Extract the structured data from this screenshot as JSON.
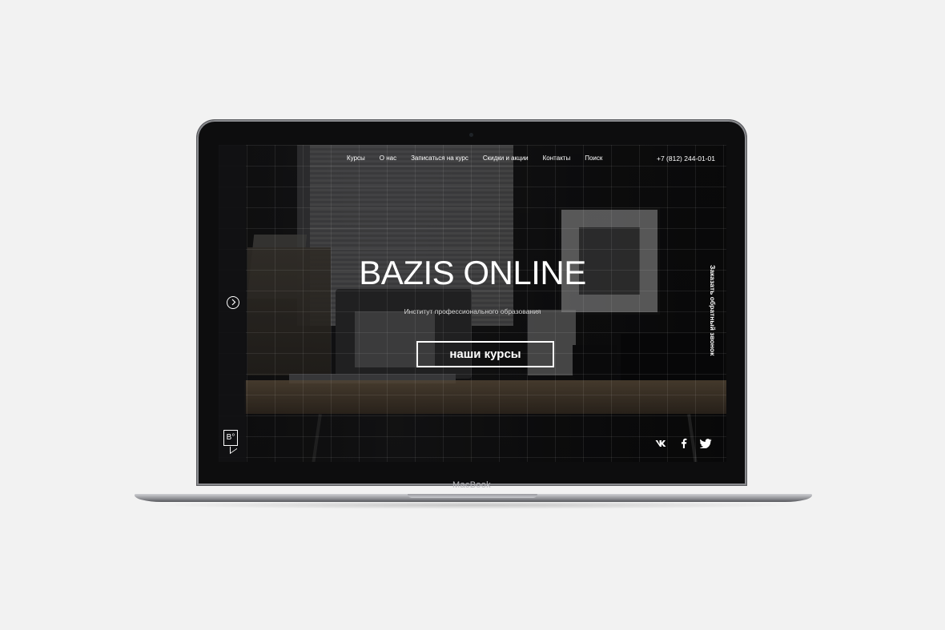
{
  "nav": {
    "items": [
      {
        "label": "Курсы"
      },
      {
        "label": "О нас"
      },
      {
        "label": "Записаться на курс"
      },
      {
        "label": "Скидки и акции"
      },
      {
        "label": "Контакты"
      },
      {
        "label": "Поиск"
      }
    ],
    "phone": "+7 (812) 244-01-01"
  },
  "hero": {
    "title": "BAZIS ONLINE",
    "subtitle": "Институт профессионального образования",
    "button_label": "наши курсы"
  },
  "callback": {
    "label": "Заказать обратный звонок"
  },
  "logo": {
    "text": "B°"
  },
  "socials": [
    {
      "icon": "vk-icon",
      "glyph": "vk"
    },
    {
      "icon": "facebook-icon",
      "glyph": "f"
    },
    {
      "icon": "twitter-icon",
      "glyph": "twitter"
    }
  ],
  "device": {
    "label": "MacBook"
  }
}
